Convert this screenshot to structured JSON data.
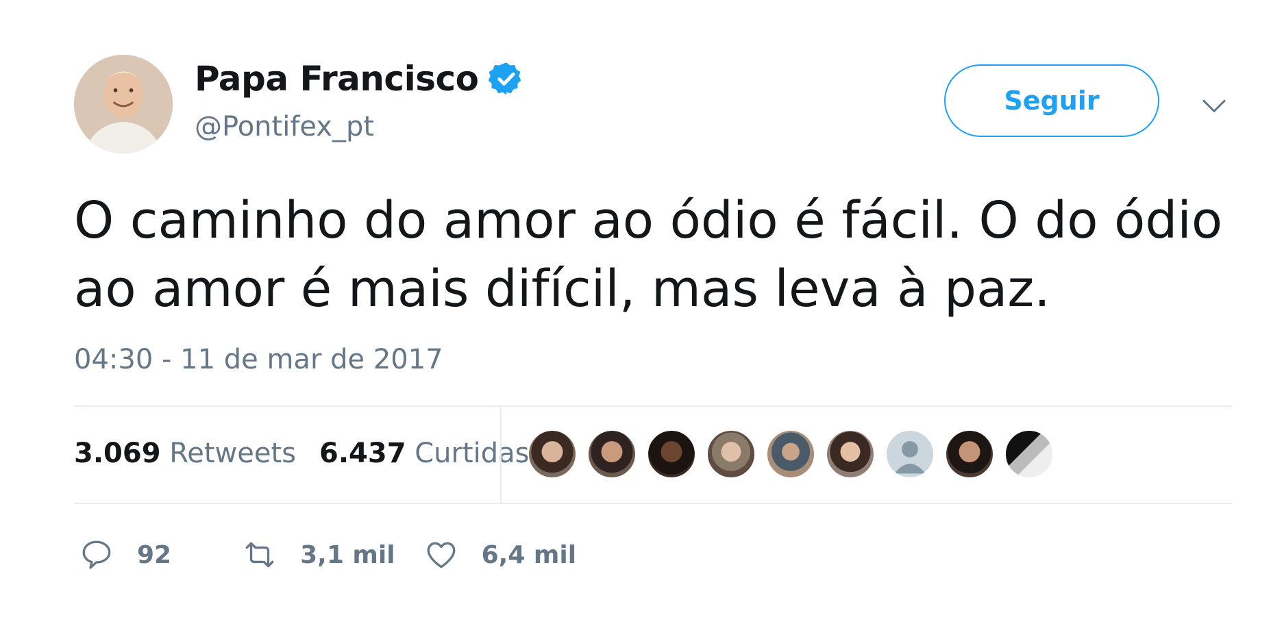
{
  "author": {
    "display_name": "Papa Francisco",
    "handle": "@Pontifex_pt",
    "verified": true,
    "avatar": "avatar-photo"
  },
  "header": {
    "follow_label": "Seguir",
    "menu_icon": "chevron-down-icon"
  },
  "tweet": {
    "text": "O caminho do amor ao ódio é fácil. O do ódio ao amor é mais difícil, mas leva à paz.",
    "timestamp": "04:30 - 11 de mar de 2017"
  },
  "stats": {
    "retweets_count": "3.069",
    "retweets_label": "Retweets",
    "likes_count": "6.437",
    "likes_label": "Curtidas"
  },
  "liked_by_avatars": [
    "avatar-1",
    "avatar-2",
    "avatar-3",
    "avatar-4",
    "avatar-5",
    "avatar-6",
    "avatar-default",
    "avatar-8",
    "avatar-9"
  ],
  "actions": {
    "reply_count": "92",
    "retweet_count": "3,1 mil",
    "like_count": "6,4 mil"
  },
  "colors": {
    "accent": "#1da1f2",
    "text": "#14171a",
    "secondary": "#657786",
    "divider": "#e6ecf0"
  }
}
